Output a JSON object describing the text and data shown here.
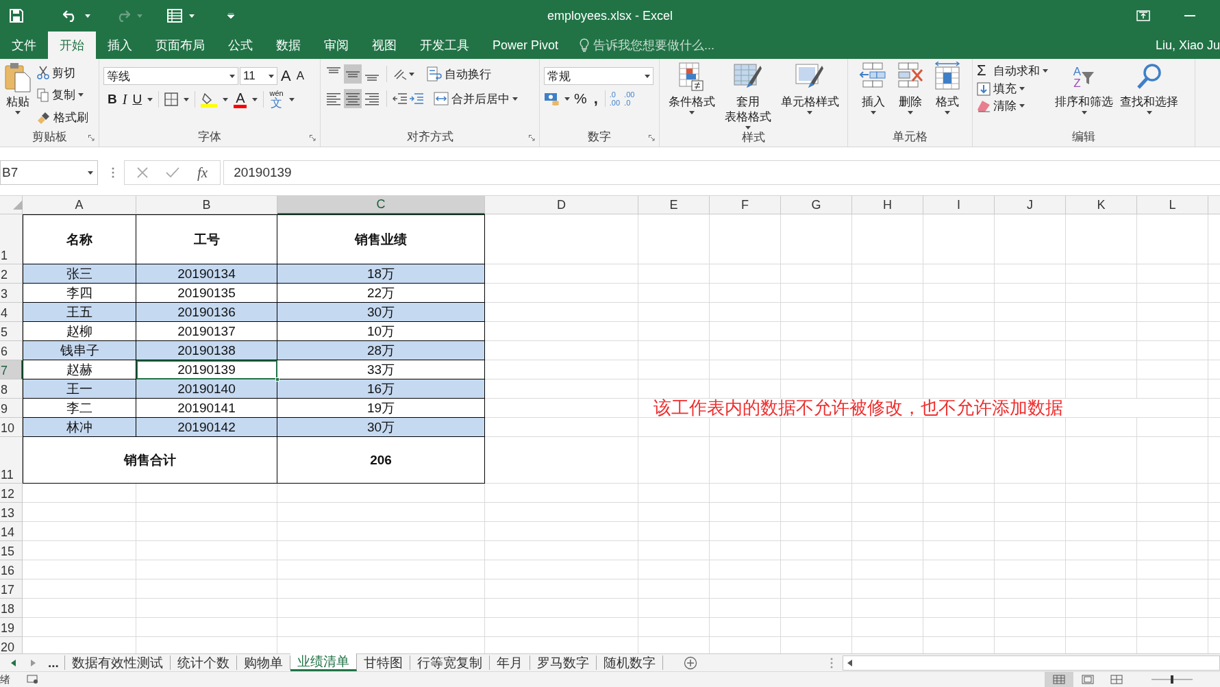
{
  "window": {
    "title": "employees.xlsx - Excel",
    "user": "Liu, Xiao Ju"
  },
  "ribbon_tabs": [
    {
      "label": "文件",
      "selected": false
    },
    {
      "label": "开始",
      "selected": true
    },
    {
      "label": "插入",
      "selected": false
    },
    {
      "label": "页面布局",
      "selected": false
    },
    {
      "label": "公式",
      "selected": false
    },
    {
      "label": "数据",
      "selected": false
    },
    {
      "label": "审阅",
      "selected": false
    },
    {
      "label": "视图",
      "selected": false
    },
    {
      "label": "开发工具",
      "selected": false
    },
    {
      "label": "Power Pivot",
      "selected": false
    }
  ],
  "tell_me": {
    "placeholder": "告诉我您想要做什么..."
  },
  "clipboard": {
    "label": "剪贴板",
    "paste": "粘贴",
    "cut": "剪切",
    "copy": "复制",
    "format_painter": "格式刷"
  },
  "font": {
    "label": "字体",
    "font_name": "等线",
    "font_size": "11",
    "grow": "A",
    "shrink": "A",
    "bold": "B",
    "italic": "I",
    "underline": "U",
    "font_color": "A",
    "phonetic_top": "wén",
    "phonetic_bottom": "文"
  },
  "alignment": {
    "label": "对齐方式",
    "vertical": [
      {
        "selected": false
      },
      {
        "selected": true
      },
      {
        "selected": false
      }
    ],
    "horizontal": [
      {
        "selected": false
      },
      {
        "selected": true
      },
      {
        "selected": false
      }
    ],
    "wrap": "自动换行",
    "merge": "合并后居中"
  },
  "number": {
    "label": "数字",
    "format": "常规",
    "percent": "%",
    "comma": ",",
    "increase_decimal": [
      ".0",
      ".00"
    ],
    "decrease_decimal": [
      ".00",
      ".0"
    ]
  },
  "styles": {
    "label": "样式",
    "buttons": [
      "条件格式",
      "套用表格格式",
      "单元格样式"
    ]
  },
  "cells": {
    "label": "单元格",
    "buttons": [
      "插入",
      "删除",
      "格式"
    ]
  },
  "editing": {
    "label": "编辑",
    "sum_symbol": "Σ",
    "autosum": "自动求和",
    "fill": "填充",
    "clear": "清除",
    "sort_letters": [
      "A",
      "Z"
    ],
    "sort": "排序和筛选",
    "find": "查找和选择"
  },
  "formula_bar": {
    "name_box": "B7",
    "fx": "fx",
    "value": "20190139"
  },
  "sheet": {
    "columns": [
      "A",
      "B",
      "C",
      "D",
      "E",
      "F",
      "G",
      "H",
      "I",
      "J",
      "K",
      "L"
    ],
    "row_numbers": [
      "1",
      "2",
      "3",
      "4",
      "5",
      "6",
      "7",
      "8",
      "9",
      "10",
      "11",
      "12",
      "13",
      "14",
      "15",
      "16",
      "17",
      "18",
      "19",
      "20"
    ],
    "header": [
      "名称",
      "工号",
      "销售业绩"
    ],
    "rows": [
      {
        "shaded": true,
        "cells": [
          {
            "text": "张三",
            "selected": false
          },
          {
            "text": "20190134",
            "selected": false
          },
          {
            "text": "18万",
            "selected": false
          }
        ]
      },
      {
        "shaded": false,
        "cells": [
          {
            "text": "李四",
            "selected": false
          },
          {
            "text": "20190135",
            "selected": false
          },
          {
            "text": "22万",
            "selected": false
          }
        ]
      },
      {
        "shaded": true,
        "cells": [
          {
            "text": "王五",
            "selected": false
          },
          {
            "text": "20190136",
            "selected": false
          },
          {
            "text": "30万",
            "selected": false
          }
        ]
      },
      {
        "shaded": false,
        "cells": [
          {
            "text": "赵柳",
            "selected": false
          },
          {
            "text": "20190137",
            "selected": false
          },
          {
            "text": "10万",
            "selected": false
          }
        ]
      },
      {
        "shaded": true,
        "cells": [
          {
            "text": "钱串子",
            "selected": false
          },
          {
            "text": "20190138",
            "selected": false
          },
          {
            "text": "28万",
            "selected": false
          }
        ]
      },
      {
        "shaded": false,
        "cells": [
          {
            "text": "赵赫",
            "selected": false
          },
          {
            "text": "20190139",
            "selected": true
          },
          {
            "text": "33万",
            "selected": false
          }
        ]
      },
      {
        "shaded": true,
        "cells": [
          {
            "text": "王一",
            "selected": false
          },
          {
            "text": "20190140",
            "selected": false
          },
          {
            "text": "16万",
            "selected": false
          }
        ]
      },
      {
        "shaded": false,
        "cells": [
          {
            "text": "李二",
            "selected": false
          },
          {
            "text": "20190141",
            "selected": false
          },
          {
            "text": "19万",
            "selected": false
          }
        ]
      },
      {
        "shaded": true,
        "cells": [
          {
            "text": "林冲",
            "selected": false
          },
          {
            "text": "20190142",
            "selected": false
          },
          {
            "text": "30万",
            "selected": false
          }
        ]
      }
    ],
    "total": {
      "label": "销售合计",
      "value": "206"
    },
    "note": "该工作表内的数据不允许被修改，也不允许添加数据"
  },
  "sheet_tabs": {
    "more": "...",
    "tabs": [
      {
        "label": "数据有效性测试",
        "selected": false
      },
      {
        "label": "统计个数",
        "selected": false
      },
      {
        "label": "购物单",
        "selected": false
      },
      {
        "label": "业绩清单",
        "selected": true
      },
      {
        "label": "甘特图",
        "selected": false
      },
      {
        "label": "行等宽复制",
        "selected": false
      },
      {
        "label": "年月",
        "selected": false
      },
      {
        "label": "罗马数字",
        "selected": false
      },
      {
        "label": "随机数字",
        "selected": false
      }
    ]
  },
  "status_bar": {
    "status": "绪",
    "zoom_slider": {
      "level": 0.5
    }
  }
}
